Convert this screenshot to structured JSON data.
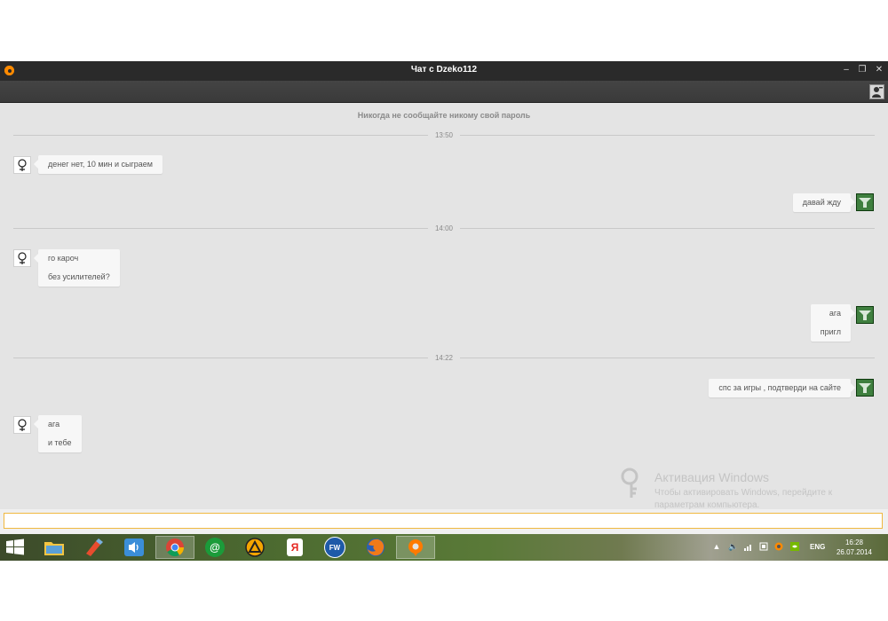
{
  "window": {
    "title": "Чат с Dzeko112",
    "minimize_glyph": "–",
    "restore_glyph": "❐",
    "close_glyph": "✕"
  },
  "notice": "Никогда не сообщайте никому свой пароль",
  "separators": [
    "13:50",
    "14:00",
    "14:22"
  ],
  "messages": [
    {
      "from": "in",
      "lines": [
        "денег нет, 10 мин и сыграем"
      ]
    },
    {
      "from": "out",
      "lines": [
        "давай жду"
      ]
    },
    {
      "from": "in",
      "lines": [
        "го кароч",
        "без усилителей?"
      ]
    },
    {
      "from": "out",
      "lines": [
        "ага",
        "пригл"
      ]
    },
    {
      "from": "out",
      "lines": [
        "спс за игры , подтверди на сайте"
      ]
    },
    {
      "from": "in",
      "lines": [
        "ага",
        "и тебе"
      ]
    }
  ],
  "input": {
    "value": "",
    "placeholder": ""
  },
  "watermark": {
    "title": "Активация Windows",
    "text": "Чтобы активировать Windows, перейдите к параметрам компьютера."
  },
  "taskbar": {
    "apps": [
      {
        "name": "explorer",
        "icon": "folder-icon"
      },
      {
        "name": "paint",
        "icon": "paint-icon"
      },
      {
        "name": "audio",
        "icon": "speaker-app-icon"
      },
      {
        "name": "chrome",
        "icon": "chrome-icon"
      },
      {
        "name": "mail-agent",
        "icon": "at-icon",
        "glyph": "@"
      },
      {
        "name": "aimp",
        "icon": "aimp-icon"
      },
      {
        "name": "yandex",
        "icon": "yandex-icon",
        "glyph": "Я"
      },
      {
        "name": "fw",
        "icon": "fw-icon",
        "glyph": "FW"
      },
      {
        "name": "firefox",
        "icon": "firefox-icon"
      },
      {
        "name": "chat-app",
        "icon": "chat-app-icon"
      }
    ],
    "language": "ENG",
    "time": "16:28",
    "date": "26.07.2014"
  },
  "colors": {
    "app_accent": "#ff8a00",
    "input_border": "#f0b840",
    "chat_background": "#e4e4e4"
  }
}
